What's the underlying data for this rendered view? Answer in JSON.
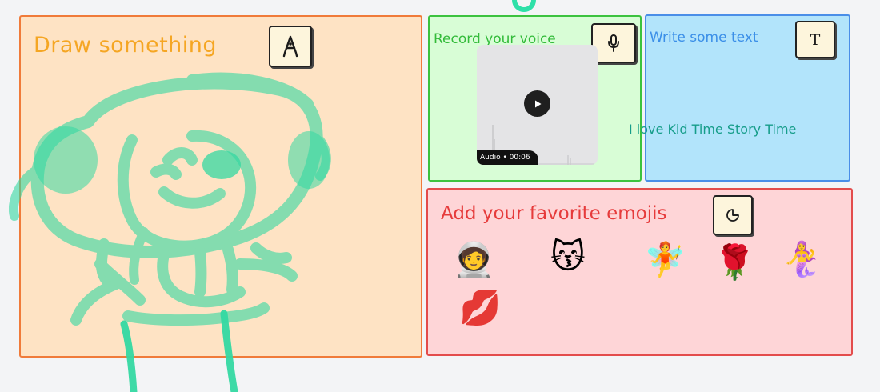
{
  "draw": {
    "title": "Draw something",
    "tool_icon": "pen-nib-icon"
  },
  "record": {
    "title": "Record your voice",
    "tool_icon": "microphone-icon",
    "audio_label": "Audio • 00:06",
    "play_icon": "play-icon"
  },
  "write": {
    "title": "Write some text",
    "tool_icon": "text-icon",
    "tool_label": "T",
    "text": "I love Kid Time Story Time"
  },
  "emojis": {
    "title": "Add your favorite emojis",
    "tool_icon": "sticker-icon",
    "items": [
      "🧑‍🚀",
      "😽",
      "🧚",
      "🌹",
      "🧜‍♀️",
      "💋"
    ]
  },
  "colors": {
    "draw_bg": "#fee3c4",
    "draw_border": "#f07b3a",
    "record_bg": "#d8fdd6",
    "record_border": "#3cc23f",
    "write_bg": "#b2e4fb",
    "write_border": "#4a8ee8",
    "emoji_bg": "#fed5d7",
    "emoji_border": "#e34c4c",
    "ink": "#34d8a2"
  }
}
